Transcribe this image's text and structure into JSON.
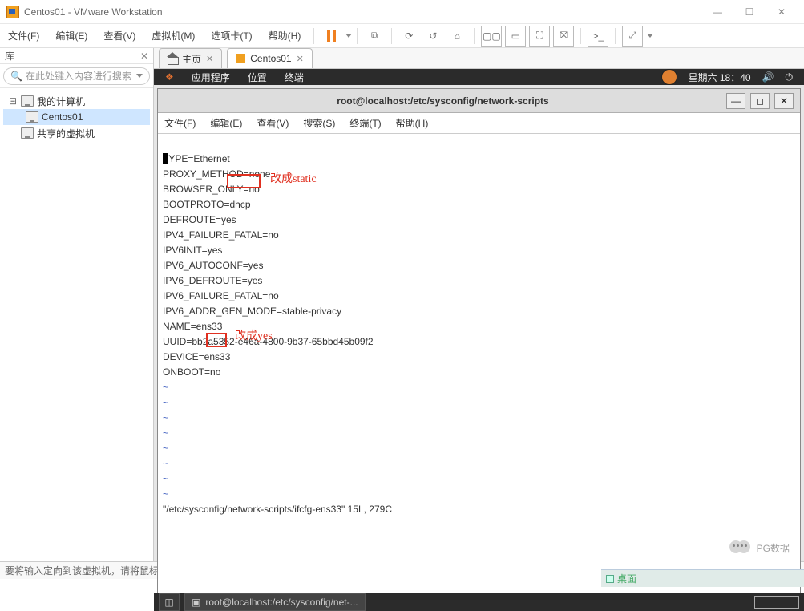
{
  "titlebar": {
    "title": "Centos01 - VMware Workstation"
  },
  "menubar": {
    "file": "文件(F)",
    "edit": "编辑(E)",
    "view": "查看(V)",
    "vm": "虚拟机(M)",
    "tabs": "选项卡(T)",
    "help": "帮助(H)"
  },
  "sidebar": {
    "tabLabel": "库",
    "searchPlaceholder": "在此处键入内容进行搜索",
    "myComputer": "我的计算机",
    "centos": "Centos01",
    "shared": "共享的虚拟机"
  },
  "tabs": {
    "home": "主页",
    "centos": "Centos01"
  },
  "gnome": {
    "apps": "应用程序",
    "places": "位置",
    "terminal": "终端",
    "clock": "星期六 18：40"
  },
  "termwin": {
    "title": "root@localhost:/etc/sysconfig/network-scripts",
    "menu": {
      "file": "文件(F)",
      "edit": "编辑(E)",
      "view": "查看(V)",
      "search": "搜索(S)",
      "terminal": "终端(T)",
      "help": "帮助(H)"
    }
  },
  "config": {
    "l1a": "T",
    "l1b": "YPE=Ethernet",
    "l2": "PROXY_METHOD=none",
    "l3": "BROWSER_ONLY=no",
    "l4a": "BOOTPROTO=",
    "l4b": "dhcp",
    "l5": "DEFROUTE=yes",
    "l6": "IPV4_FAILURE_FATAL=no",
    "l7": "IPV6INIT=yes",
    "l8": "IPV6_AUTOCONF=yes",
    "l9": "IPV6_DEFROUTE=yes",
    "l10": "IPV6_FAILURE_FATAL=no",
    "l11": "IPV6_ADDR_GEN_MODE=stable-privacy",
    "l12": "NAME=ens33",
    "l13": "UUID=bb2a5352-e46a-4800-9b37-65bbd45b09f2",
    "l14": "DEVICE=ens33",
    "l15a": "ONBOOT=",
    "l15b": "no",
    "status": "\"/etc/sysconfig/network-scripts/ifcfg-ens33\" 15L, 279C"
  },
  "annotations": {
    "a1": "改成static",
    "a2": "改成yes"
  },
  "dock": {
    "task": "root@localhost:/etc/sysconfig/net-..."
  },
  "status": {
    "hint": "要将输入定向到该虚拟机，请将鼠标指针移入其中或按 Ctrl+G。"
  },
  "watermark": {
    "text": "PG数据"
  },
  "desktop": {
    "label": "桌面"
  }
}
